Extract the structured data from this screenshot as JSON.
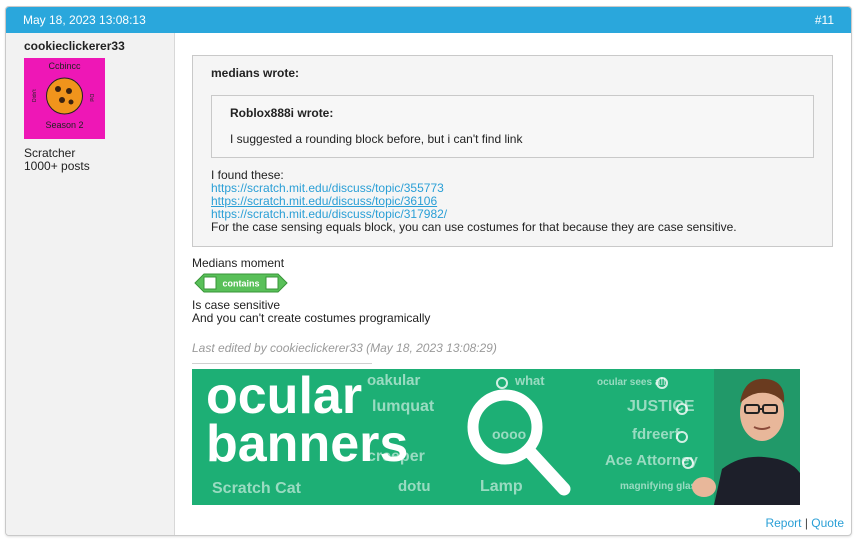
{
  "post": {
    "timestamp": "May 18, 2023 13:08:13",
    "number": "#11"
  },
  "author": {
    "username": "cookieclickerer33",
    "rank": "Scratcher",
    "post_count": "1000+ posts",
    "avatar_text": [
      "Ccbincc",
      "Season 2",
      "Did",
      "Didn't"
    ]
  },
  "quote": {
    "author": "medians wrote:",
    "nested": {
      "author": "Roblox888i wrote:",
      "text": "I suggested a rounding block before, but i can't find link"
    },
    "intro": "I found these:",
    "links": [
      "https://scratch.mit.edu/discuss/topic/355773",
      "https://scratch.mit.edu/discuss/topic/36106",
      "https://scratch.mit.edu/discuss/topic/317982/"
    ],
    "closing": "For the case sensing equals block, you can use costumes for that because they are case sensitive."
  },
  "reply": {
    "line1": "Medians moment",
    "block_label": "contains",
    "line2": "Is case sensitive",
    "line3": "And you can't create costumes programically"
  },
  "edited": "Last edited by cookieclickerer33 (May 18, 2023 13:08:29)",
  "signature": {
    "banner_title_1": "ocular",
    "banner_title_2": "banners",
    "tiles": [
      "oakular",
      "what",
      "ocular sees all",
      "lumquat",
      "JUSTICE",
      "fdreerf",
      "Ace Attorney",
      "creeper",
      "dotu",
      "Lamp",
      "Scratch Cat",
      "magnifying glass",
      "oooo"
    ]
  },
  "actions": {
    "report": "Report",
    "separator": "|",
    "quote": "Quote"
  },
  "colors": {
    "header": "#2aa7dc",
    "link": "#2a9fd6",
    "banner": "#20b479",
    "block": "#59c059"
  }
}
